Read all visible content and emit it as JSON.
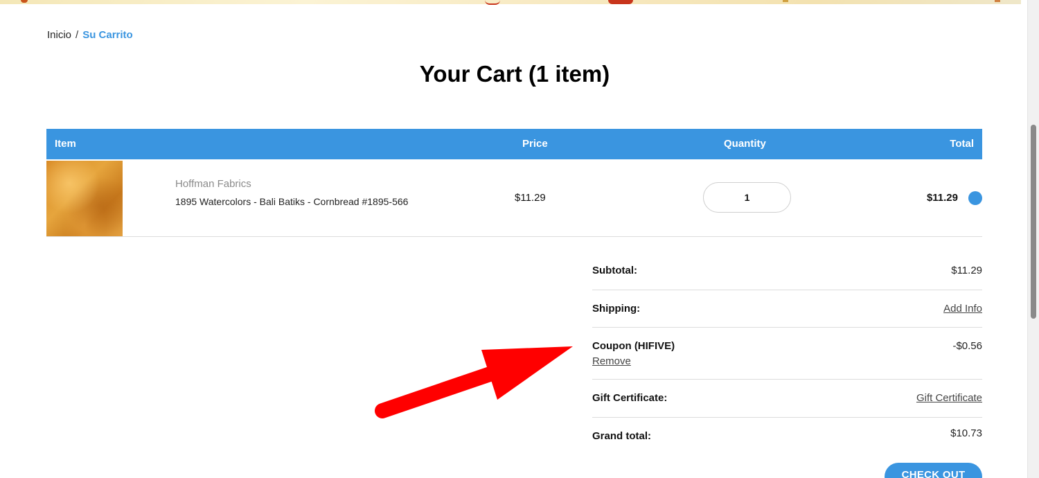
{
  "breadcrumb": {
    "home": "Inicio",
    "separator": "/",
    "current": "Su Carrito"
  },
  "page": {
    "title": "Your Cart (1 item)"
  },
  "cart": {
    "headers": {
      "item": "Item",
      "price": "Price",
      "quantity": "Quantity",
      "total": "Total"
    },
    "items": [
      {
        "brand": "Hoffman Fabrics",
        "name": "1895 Watercolors - Bali Batiks - Cornbread #1895-566",
        "price": "$11.29",
        "quantity": "1",
        "total": "$11.29"
      }
    ]
  },
  "summary": {
    "subtotal_label": "Subtotal:",
    "subtotal_value": "$11.29",
    "shipping_label": "Shipping:",
    "shipping_link": "Add Info",
    "coupon_label": "Coupon (HIFIVE)",
    "coupon_value": "-$0.56",
    "coupon_remove": "Remove",
    "gift_label": "Gift Certificate:",
    "gift_link": "Gift Certificate",
    "grand_label": "Grand total:",
    "grand_value": "$10.73"
  },
  "checkout": {
    "label": "CHECK OUT"
  },
  "colors": {
    "accent": "#3a95e0",
    "annotation_arrow": "#ff0000"
  }
}
